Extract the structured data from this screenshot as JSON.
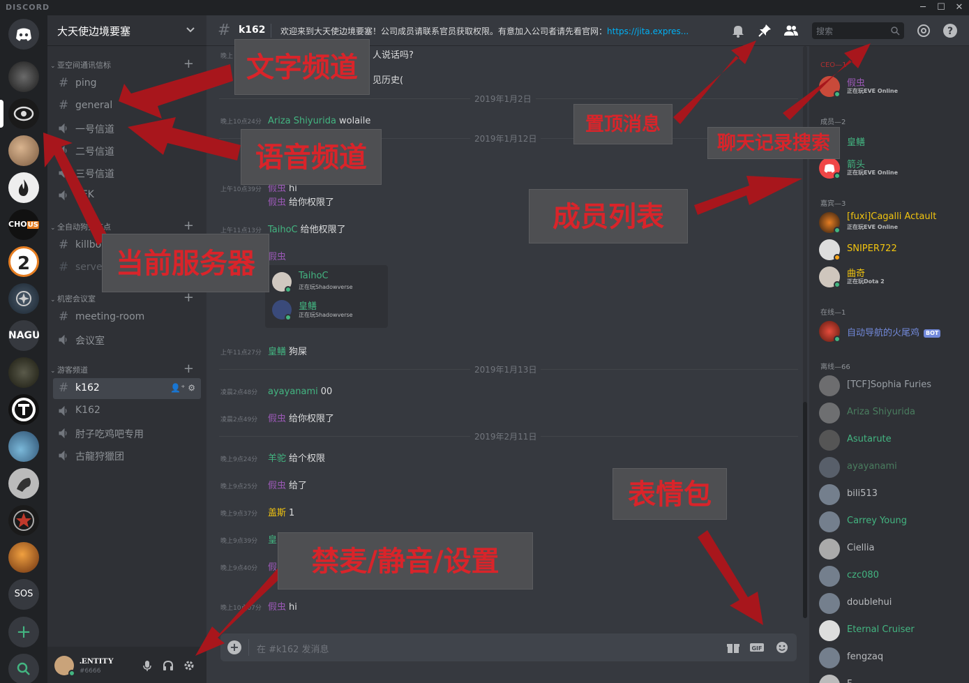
{
  "titlebar": {
    "logo": "DISCORD",
    "minimize": "─",
    "maximize": "☐",
    "close": "✕"
  },
  "guilds": [
    {
      "name": "home",
      "label": ""
    },
    {
      "name": "server-1",
      "label": ""
    },
    {
      "name": "server-2",
      "label": ""
    },
    {
      "name": "server-3",
      "label": ""
    },
    {
      "name": "server-4",
      "label": ""
    },
    {
      "name": "chous",
      "label": "CHO"
    },
    {
      "name": "server-2-badge",
      "label": "2"
    },
    {
      "name": "star-citizen",
      "label": ""
    },
    {
      "name": "nagu",
      "label": "NAGU"
    },
    {
      "name": "server-frontier",
      "label": ""
    },
    {
      "name": "server-tf",
      "label": ""
    },
    {
      "name": "server-blue",
      "label": ""
    },
    {
      "name": "server-grey",
      "label": ""
    },
    {
      "name": "server-red-star",
      "label": ""
    },
    {
      "name": "server-orange",
      "label": ""
    },
    {
      "name": "sos",
      "label": "SOS"
    }
  ],
  "server": {
    "name": "大天使边境要塞"
  },
  "categories": [
    {
      "label": "亚空间通讯信标"
    },
    {
      "label": "全自动狗头节点"
    },
    {
      "label": "机密会议室"
    },
    {
      "label": "游客频道"
    }
  ],
  "channels": [
    {
      "name": "ping",
      "type": "text"
    },
    {
      "name": "general",
      "type": "text"
    },
    {
      "name": "一号信道",
      "type": "voice"
    },
    {
      "name": "二号信道",
      "type": "voice"
    },
    {
      "name": "三号信道",
      "type": "voice"
    },
    {
      "name": "AFK",
      "type": "voice"
    },
    {
      "name": "killboard",
      "type": "text"
    },
    {
      "name": "server",
      "type": "text"
    },
    {
      "name": "meeting-room",
      "type": "text"
    },
    {
      "name": "会议室",
      "type": "voice"
    },
    {
      "name": "k162",
      "type": "text",
      "selected": true
    },
    {
      "name": "K162",
      "type": "voice"
    },
    {
      "name": "肘子吃鸡吧专用",
      "type": "voice"
    },
    {
      "name": "古龍狩獵团",
      "type": "voice"
    }
  ],
  "user": {
    "name": ".ENTITY",
    "tag": "#6666"
  },
  "header": {
    "channel": "k162",
    "topic": "欢迎来到大天使边境要塞！公司成员请联系官员获取权限。有意加入公司者请先看官网：",
    "topic_link": "https://jita.expres...",
    "search_placeholder": "搜索"
  },
  "messages": [
    {
      "time": "晚上",
      "author": "",
      "text": "人说话吗?",
      "color": "#dcddde"
    },
    {
      "time": "",
      "author": "",
      "text": "见历史(",
      "color": "#dcddde"
    },
    {
      "time": "晚上10点24分",
      "author": "Ariza Shiyurida",
      "text": "wolaile",
      "color": "#43b581"
    },
    {
      "time": "上午",
      "author": "",
      "text": "",
      "color": "#dcddde"
    },
    {
      "time": "上午10点39分",
      "author": "假虫",
      "text": "hi",
      "color": "#9b59b6"
    },
    {
      "time": "",
      "author": "假虫",
      "text": "给你权限了",
      "color": "#9b59b6"
    },
    {
      "time": "上午11点13分",
      "author": "TaihoC",
      "text": "给他权限了",
      "color": "#43b581"
    },
    {
      "time": "",
      "author": "假虫",
      "text": "",
      "color": "#9b59b6"
    },
    {
      "time": "上午11点27分",
      "author": "皇鳝",
      "text": "狗屎",
      "color": "#43b581"
    },
    {
      "time": "凌晨2点48分",
      "author": "ayayanami",
      "text": "00",
      "color": "#43b581"
    },
    {
      "time": "凌晨2点49分",
      "author": "假虫",
      "text": "给你权限了",
      "color": "#9b59b6"
    },
    {
      "time": "晚上9点24分",
      "author": "羊驼",
      "text": "给个权限",
      "color": "#43b581"
    },
    {
      "time": "晚上9点25分",
      "author": "假虫",
      "text": "给了",
      "color": "#9b59b6"
    },
    {
      "time": "晚上9点37分",
      "author": "盖斯",
      "text": "1",
      "color": "#f1c40f"
    },
    {
      "time": "晚上9点39分",
      "author": "皇",
      "text": "",
      "color": "#43b581"
    },
    {
      "time": "晚上9点40分",
      "author": "假",
      "text": "",
      "color": "#9b59b6"
    },
    {
      "time": "晚上10点07分",
      "author": "假虫",
      "text": "hi",
      "color": "#9b59b6"
    }
  ],
  "dividers": [
    "2019年1月2日",
    "2019年1月12日",
    "2019年1月13日",
    "2019年2月11日"
  ],
  "embed": [
    {
      "name": "TaihoC",
      "status": "正在玩Shadowverse"
    },
    {
      "name": "皇鳝",
      "status": "正在玩Shadowverse"
    }
  ],
  "composer": {
    "placeholder": "在 #k162 发消息"
  },
  "member_groups": [
    {
      "label": "CEO—1"
    },
    {
      "label": "成员—2"
    },
    {
      "label": "嘉宾—3"
    },
    {
      "label": "在线—1"
    },
    {
      "label": "离线—66"
    }
  ],
  "members": [
    {
      "name": "假虫",
      "status": "正在玩EVE Online",
      "color": "#9b59b6",
      "presence": "#43b581"
    },
    {
      "name": "皇鳝",
      "status": "",
      "color": "#43b581",
      "presence": "#43b581"
    },
    {
      "name": "箭头",
      "status": "正在玩EVE Online",
      "color": "#43b581",
      "presence": "#43b581"
    },
    {
      "name": "[fuxi]Cagalli Actault",
      "status": "正在玩EVE Online",
      "color": "#f1c40f",
      "presence": "#43b581"
    },
    {
      "name": "SNIPER722",
      "status": "",
      "color": "#f1c40f",
      "presence": "#faa61a"
    },
    {
      "name": "曲奇",
      "status": "正在玩Dota 2",
      "color": "#f1c40f",
      "presence": "#43b581"
    },
    {
      "name": "自动导航的火尾鸡",
      "status": "",
      "color": "#7289da",
      "presence": "#43b581",
      "bot": "BOT"
    },
    {
      "name": "[TCF]Sophia Furies",
      "color": "#9aa0a6"
    },
    {
      "name": "Ariza Shiyurida",
      "color": "#4a7d5f"
    },
    {
      "name": "Asutarute",
      "color": "#43b581"
    },
    {
      "name": "ayayanami",
      "color": "#4a7d5f"
    },
    {
      "name": "bili513",
      "color": "#b9bbbe"
    },
    {
      "name": "Carrey Young",
      "color": "#43b581"
    },
    {
      "name": "Ciellia",
      "color": "#b9bbbe"
    },
    {
      "name": "czc080",
      "color": "#43b581"
    },
    {
      "name": "doublehui",
      "color": "#b9bbbe"
    },
    {
      "name": "Eternal Cruiser",
      "color": "#43b581"
    },
    {
      "name": "fengzaq",
      "color": "#b9bbbe"
    },
    {
      "name": "F",
      "color": "#b9bbbe"
    }
  ],
  "annotations": {
    "text_channel": "文字频道",
    "voice_channel": "语音频道",
    "current_server": "当前服务器",
    "pinned": "置顶消息",
    "chat_search": "聊天记录搜索",
    "member_list": "成员列表",
    "emoji": "表情包",
    "mute_settings": "禁麦/静音/设置"
  }
}
